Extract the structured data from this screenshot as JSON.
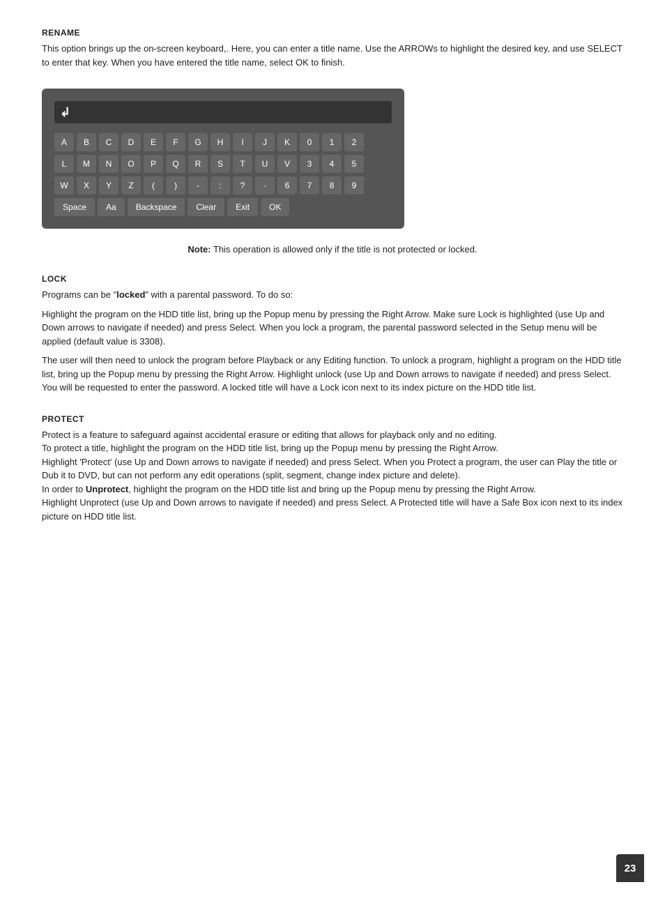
{
  "rename": {
    "title": "RENAME",
    "description": "This option brings up the on-screen keyboard,. Here, you can enter a title name. Use the ARROWs to highlight the desired key, and use SELECT to enter that key. When you have entered the title name, select OK to finish."
  },
  "keyboard": {
    "row1": [
      "A",
      "B",
      "C",
      "D",
      "E",
      "F",
      "G",
      "H",
      "I",
      "J",
      "K",
      "0",
      "1",
      "2"
    ],
    "row2": [
      "L",
      "M",
      "N",
      "O",
      "P",
      "Q",
      "R",
      "S",
      "T",
      "U",
      "V",
      "3",
      "4",
      "5"
    ],
    "row3": [
      "W",
      "X",
      "Y",
      "Z",
      "(",
      ")",
      "-",
      ":",
      "?",
      "·",
      "6",
      "7",
      "8",
      "9"
    ],
    "row4_buttons": [
      "Space",
      "Aa",
      "Backspace",
      "Clear",
      "Exit",
      "OK"
    ]
  },
  "note": {
    "bold": "Note:",
    "text": " This operation is allowed only if the title is not protected or locked."
  },
  "lock": {
    "title": "LOCK",
    "p1": "Programs can be \"locked\" with a parental password. To do so:",
    "p2": "Highlight the program on the HDD title list, bring up the Popup menu by pressing the Right Arrow. Make sure Lock is highlighted (use Up and Down arrows to navigate if needed) and press Select. When you lock a program, the parental password selected in the Setup menu will be applied (default value is 3308).",
    "p3": "The user will then need to unlock the program before Playback or any Editing function. To unlock a program, highlight a program on the HDD title list, bring up the Popup menu by pressing the Right Arrow. Highlight unlock (use Up and Down arrows to navigate if needed) and press Select. You will be requested to enter the password. A locked title will have a Lock icon next to its index picture on the HDD title list."
  },
  "protect": {
    "title": "PROTECT",
    "p1": "Protect is a feature to safeguard against accidental erasure or editing that allows for playback only and no editing.",
    "p2": "To protect a title, highlight the program on the HDD title list, bring up the Popup menu by pressing the Right Arrow.",
    "p3": "Highlight 'Protect' (use Up and Down arrows to navigate if needed) and press Select. When you Protect a program, the user can Play the title or Dub it to DVD, but can not perform any edit operations (split, segment, change index picture and delete).",
    "p4_pre": "In order to ",
    "p4_bold": "Unprotect",
    "p4_mid": ", highlight the program on the HDD title list and bring up the Popup menu by pressing the Right Arrow.",
    "p5": "Highlight Unprotect (use Up and Down arrows to navigate if needed) and press Select. A Protected title will have a Safe Box icon next to its index picture on HDD title list."
  },
  "page_number": "23"
}
